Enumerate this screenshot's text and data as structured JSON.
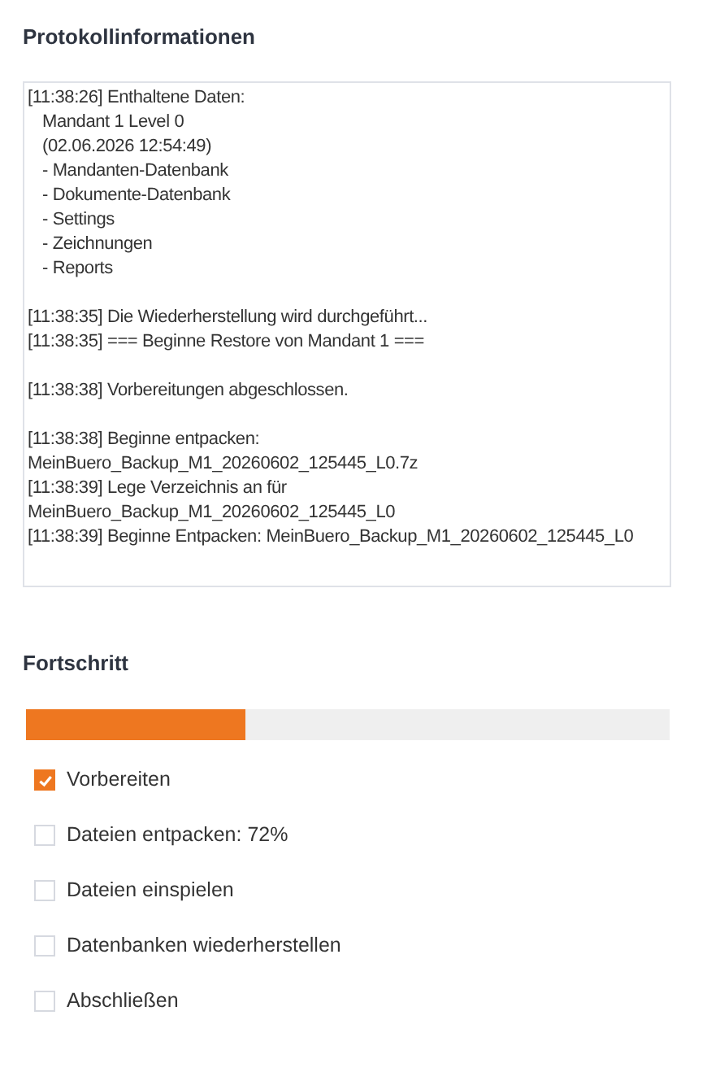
{
  "log_section": {
    "title": "Protokollinformationen",
    "groups": [
      {
        "lines": [
          {
            "text": "[11:38:26] Enthaltene Daten:",
            "indented": false
          },
          {
            "text": "Mandant 1 Level 0",
            "indented": true
          },
          {
            "text": "(02.06.2026 12:54:49)",
            "indented": true
          },
          {
            "text": "- Mandanten-Datenbank",
            "indented": true
          },
          {
            "text": "- Dokumente-Datenbank",
            "indented": true
          },
          {
            "text": "- Settings",
            "indented": true
          },
          {
            "text": "- Zeichnungen",
            "indented": true
          },
          {
            "text": "- Reports",
            "indented": true
          }
        ]
      },
      {
        "lines": [
          {
            "text": "[11:38:35] Die Wiederherstellung wird durchgeführt...",
            "indented": false
          },
          {
            "text": "[11:38:35] === Beginne Restore von Mandant 1 ===",
            "indented": false
          }
        ]
      },
      {
        "lines": [
          {
            "text": "[11:38:38] Vorbereitungen abgeschlossen.",
            "indented": false
          }
        ]
      },
      {
        "lines": [
          {
            "text": "[11:38:38] Beginne entpacken:",
            "indented": false
          },
          {
            "text": "MeinBuero_Backup_M1_20260602_125445_L0.7z",
            "indented": false
          },
          {
            "text": "[11:38:39] Lege Verzeichnis an für",
            "indented": false
          },
          {
            "text": "MeinBuero_Backup_M1_20260602_125445_L0",
            "indented": false
          },
          {
            "text": "[11:38:39] Beginne Entpacken: MeinBuero_Backup_M1_20260602_125445_L0",
            "indented": false
          }
        ]
      }
    ]
  },
  "progress_section": {
    "title": "Fortschritt",
    "level": 0.34,
    "steps": [
      {
        "label": "Vorbereiten",
        "checked": true
      },
      {
        "label": "Dateien entpacken: 72%",
        "checked": false
      },
      {
        "label": "Dateien einspielen",
        "checked": false
      },
      {
        "label": "Datenbanken wiederherstellen",
        "checked": false
      },
      {
        "label": "Abschließen",
        "checked": false
      }
    ]
  }
}
